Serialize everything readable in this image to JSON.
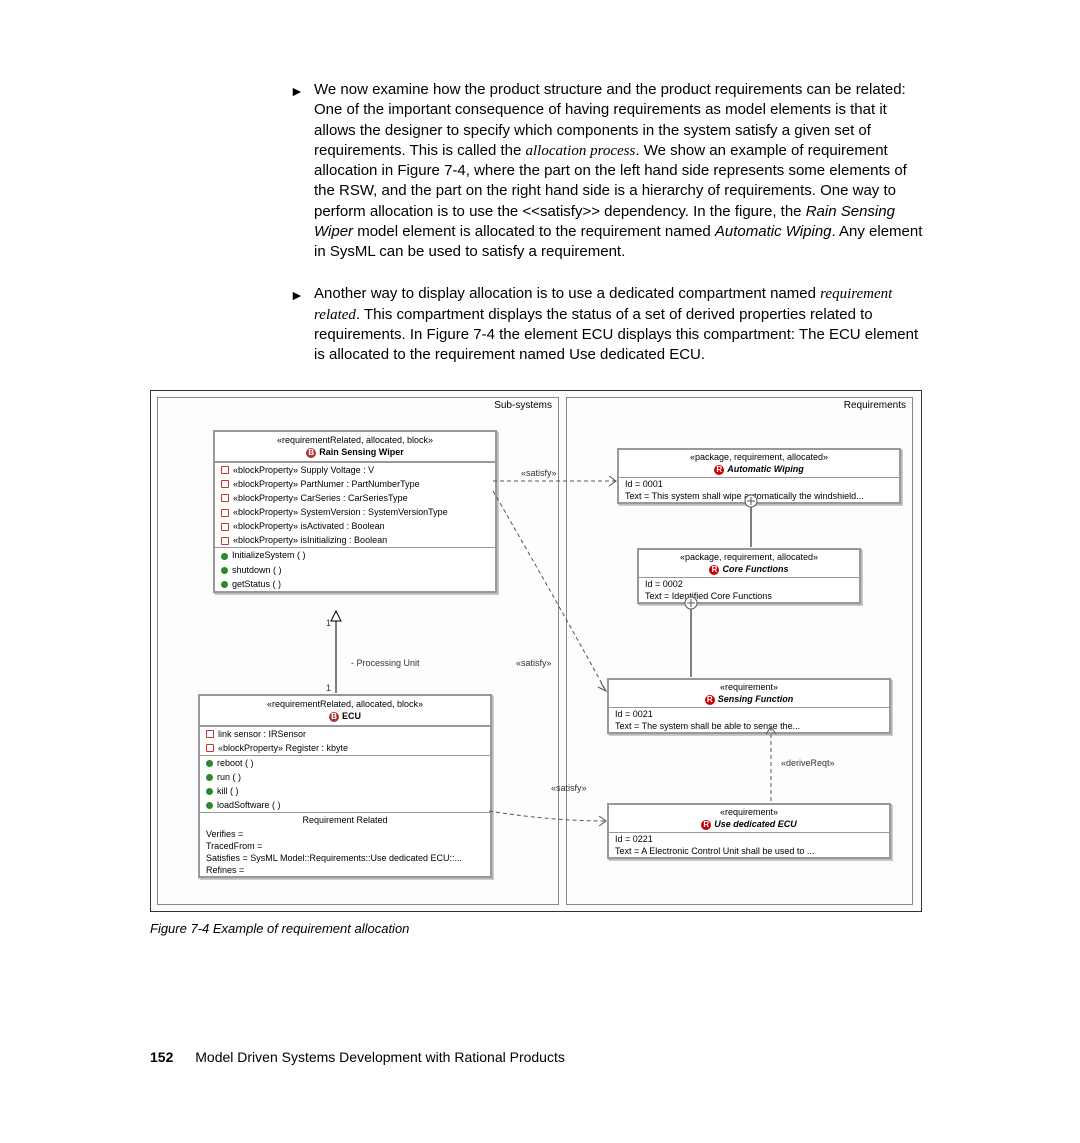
{
  "bullets": [
    {
      "pre": "We now examine how the product structure and the product requirements can be related: One of the important consequence of having requirements as model elements is that it allows the designer to specify which components in the system satisfy a given set of requirements. This is called the ",
      "em1": "allocation process",
      "mid": ". We show an example of requirement allocation in Figure 7-4, where the part on the left hand side represents some elements of the RSW, and the part on the right hand side is a hierarchy of requirements. One way to perform allocation is to use the <<satisfy>> dependency. In the figure, the ",
      "em2": "Rain Sensing Wiper",
      "mid2": " model element is allocated to the requirement named ",
      "em3": "Automatic Wiping",
      "post": ". Any element in SysML can be used to satisfy a requirement."
    },
    {
      "pre": "Another way to display allocation is to use a dedicated compartment named ",
      "em1": "requirement related",
      "mid": ". This compartment displays the status of a set of derived properties related to requirements. In Figure 7-4 the element ECU displays this compartment: The ECU element is allocated to the requirement named Use dedicated ECU.",
      "em2": "",
      "mid2": "",
      "em3": "",
      "post": ""
    }
  ],
  "figure": {
    "left_label": "Sub-systems",
    "right_label": "Requirements",
    "rsw": {
      "stereo": "«requirementRelated, allocated, block»",
      "name": "Rain Sensing Wiper",
      "props": [
        "«blockProperty» Supply Voltage : V",
        "«blockProperty» PartNumer : PartNumberType",
        "«blockProperty» CarSeries : CarSeriesType",
        "«blockProperty» SystemVersion : SystemVersionType",
        "«blockProperty» isActivated : Boolean",
        "«blockProperty» isInitializing : Boolean"
      ],
      "ops": [
        "InitializeSystem ( )",
        "shutdown ( )",
        "getStatus ( )"
      ]
    },
    "assoc": {
      "m1": "1",
      "m2": "1",
      "role": "- Processing Unit"
    },
    "ecu": {
      "stereo": "«requirementRelated, allocated, block»",
      "name": "ECU",
      "props": [
        "link sensor : IRSensor",
        "«blockProperty» Register : kbyte"
      ],
      "ops": [
        "reboot ( )",
        "run ( )",
        "kill ( )",
        "loadSoftware ( )"
      ],
      "rr_title": "Requirement Related",
      "rr": [
        "Verifies =",
        "TracedFrom =",
        "Satisfies = SysML Model::Requirements::Use  dedicated ECU::...",
        "Refines ="
      ]
    },
    "reqs": {
      "aw": {
        "stereo": "«package, requirement, allocated»",
        "name": "Automatic Wiping",
        "id": "Id = 0001",
        "text": "Text = This system shall wipe automatically the windshield..."
      },
      "cf": {
        "stereo": "«package, requirement, allocated»",
        "name": "Core Functions",
        "id": "Id = 0002",
        "text": "Text = Identified Core Functions"
      },
      "sf": {
        "stereo": "«requirement»",
        "name": "Sensing Function",
        "id": "Id = 0021",
        "text": "Text = The system shall be able to sense the..."
      },
      "ude": {
        "stereo": "«requirement»",
        "name": "Use  dedicated ECU",
        "id": "Id = 0221",
        "text": "Text = A Electronic Control Unit shall be used to ..."
      }
    },
    "edge_labels": {
      "satisfy": "«satisfy»",
      "derive": "«deriveReqt»"
    }
  },
  "caption": "Figure 7-4   Example of requirement allocation",
  "footer": {
    "page": "152",
    "title": "Model Driven Systems Development with Rational Products"
  }
}
